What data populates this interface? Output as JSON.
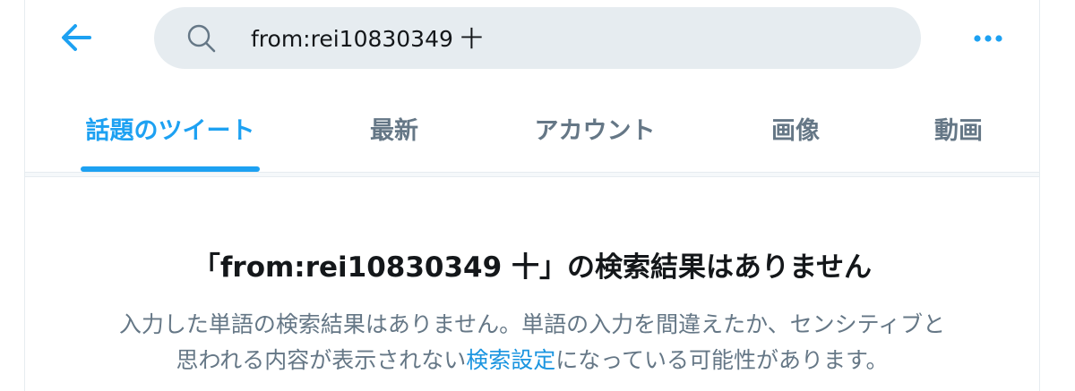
{
  "colors": {
    "accent": "#1da1f2",
    "link": "#1b95e0",
    "text_primary": "#14171a",
    "text_secondary": "#657786",
    "search_bg": "#e6ecf0"
  },
  "header": {
    "back_icon": "arrow-left-icon",
    "search": {
      "icon": "search-icon",
      "value": "from:rei10830349 十"
    },
    "more_icon": "more-horizontal-icon"
  },
  "tabs": [
    {
      "label": "話題のツイート",
      "active": true
    },
    {
      "label": "最新",
      "active": false
    },
    {
      "label": "アカウント",
      "active": false
    },
    {
      "label": "画像",
      "active": false
    },
    {
      "label": "動画",
      "active": false
    }
  ],
  "empty_state": {
    "title": "「from:rei10830349 十」の検索結果はありません",
    "description_line1": "入力した単語の検索結果はありません。単語の入力を間違えたか、センシティブと",
    "description_line2_before": "思われる内容が表示されない",
    "description_link": "検索設定",
    "description_line2_after": "になっている可能性があります。"
  }
}
